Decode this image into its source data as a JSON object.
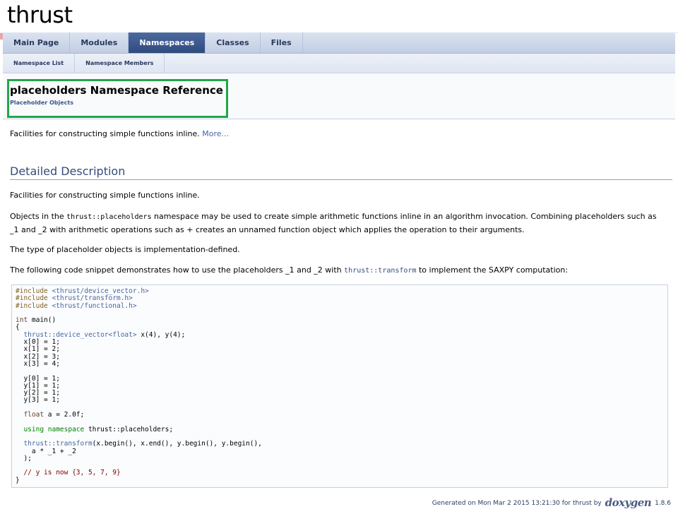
{
  "project": {
    "name": "thrust"
  },
  "tabs": [
    {
      "label": "Main Page",
      "active": false
    },
    {
      "label": "Modules",
      "active": false
    },
    {
      "label": "Namespaces",
      "active": true
    },
    {
      "label": "Classes",
      "active": false
    },
    {
      "label": "Files",
      "active": false
    }
  ],
  "subtabs": [
    {
      "label": "Namespace List"
    },
    {
      "label": "Namespace Members"
    }
  ],
  "header": {
    "title": "placeholders Namespace Reference",
    "ingroup": "Placeholder Objects"
  },
  "brief": {
    "text": "Facilities for constructing simple functions inline.",
    "more": "More..."
  },
  "detailed": {
    "heading": "Detailed Description",
    "p1": "Facilities for constructing simple functions inline.",
    "p2_a": "Objects in the ",
    "p2_code": "thrust::placeholders",
    "p2_b": " namespace may be used to create simple arithmetic functions inline in an algorithm invocation. Combining placeholders such as _1 and _2 with arithmetic operations such as + creates an unnamed function object which applies the operation to their arguments.",
    "p3": "The type of placeholder objects is implementation-defined.",
    "p4_a": "The following code snippet demonstrates how to use the placeholders _1 and _2 with ",
    "p4_link": "thrust::transform",
    "p4_b": " to implement the SAXPY computation:"
  },
  "code": {
    "l1_pp": "#include ",
    "l1_h": "<thrust/device_vector.h>",
    "l2_pp": "#include ",
    "l2_h": "<thrust/transform.h>",
    "l3_pp": "#include ",
    "l3_h": "<thrust/functional.h>",
    "l5_kw": "int",
    "l5_rest": " main()",
    "l6": "{",
    "l7_lnk": "  thrust::device_vector<float>",
    "l7_rest": " x(4), y(4);",
    "l8": "  x[0] = 1;",
    "l9": "  x[1] = 2;",
    "l10": "  x[2] = 3;",
    "l11": "  x[3] = 4;",
    "l13": "  y[0] = 1;",
    "l14": "  y[1] = 1;",
    "l15": "  y[2] = 1;",
    "l16": "  y[3] = 1;",
    "l18_kw": "  float",
    "l18_rest": " a = 2.0f;",
    "l20_kw": "  using namespace",
    "l20_rest": " thrust::placeholders;",
    "l22_lnk": "  thrust::transform",
    "l22_rest": "(x.begin(), x.end(), y.begin(), y.begin(),",
    "l23": "    a * _1 + _2",
    "l24": "  );",
    "l26_cmt": "  // y is now {3, 5, 7, 9}",
    "l27": "}"
  },
  "footer": {
    "text": "Generated on Mon Mar 2 2015 13:21:30 for thrust by",
    "logo": "doxygen",
    "version": "1.8.6"
  }
}
